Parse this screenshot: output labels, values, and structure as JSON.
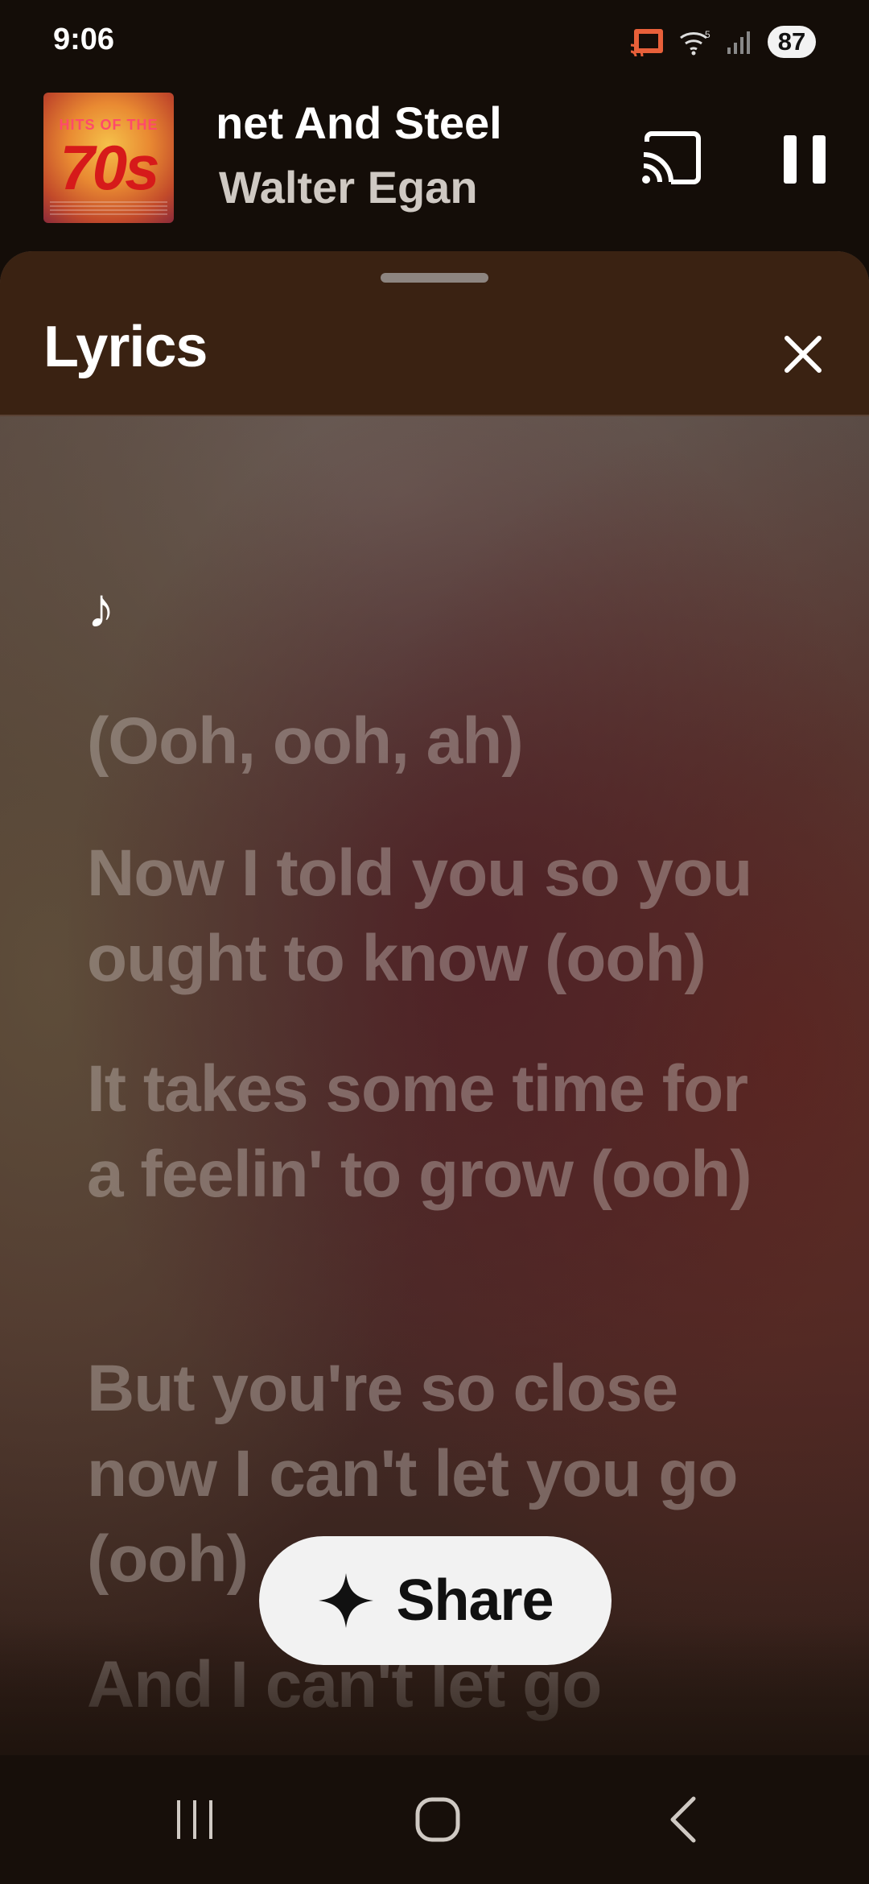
{
  "status_bar": {
    "time": "9:06",
    "battery": "87",
    "icons": [
      "cast-connected-icon",
      "wifi-icon",
      "signal-icon",
      "battery-icon"
    ]
  },
  "mini_player": {
    "album_art": {
      "top_text": "HITS OF THE",
      "big_text": "70s"
    },
    "title_visible": "net And Steel",
    "artist": "Walter Egan",
    "cast_icon": "cast-icon",
    "pause_icon": "pause-icon"
  },
  "lyrics_sheet": {
    "title": "Lyrics",
    "close_icon": "close-icon",
    "music_note": "♪",
    "lines": [
      "(Ooh, ooh, ah)",
      "Now I told you so you ought to know (ooh)",
      "It takes some time for a feelin' to grow (ooh)",
      "But you're so close now I can't let you go (ooh)",
      "And I can't let go"
    ],
    "share_label": "Share",
    "share_icon": "sparkle-icon"
  },
  "nav_bar": {
    "icons": [
      "recents-icon",
      "home-icon",
      "back-icon"
    ]
  },
  "colors": {
    "background": "#140d08",
    "sheet_header": "#3a2212",
    "lyric_inactive": "rgba(200,190,185,0.42)",
    "share_button": "#f2f2f2"
  }
}
